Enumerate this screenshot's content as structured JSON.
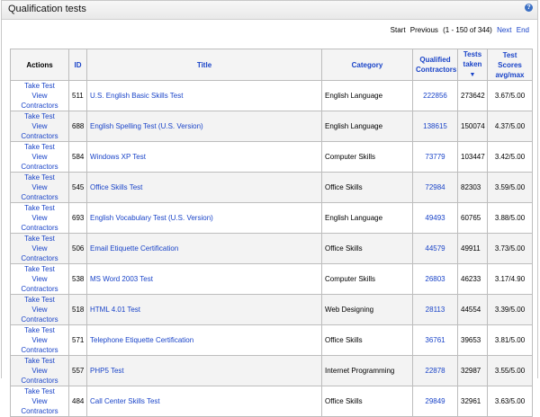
{
  "panel": {
    "title": "Qualification tests",
    "help_icon": "?"
  },
  "pager": {
    "start": "Start",
    "previous": "Previous",
    "range": "(1 - 150 of 344)",
    "next": "Next",
    "end": "End"
  },
  "columns": {
    "actions": "Actions",
    "id": "ID",
    "title": "Title",
    "category": "Category",
    "qualified_line1": "Qualified",
    "qualified_line2": "Contractors",
    "taken_line1": "Tests",
    "taken_line2": "taken",
    "scores_line1": "Test Scores",
    "scores_line2": "avg/max"
  },
  "actions": {
    "take": "Take Test",
    "view": "View Contractors"
  },
  "rows": [
    {
      "id": "511",
      "title": "U.S. English Basic Skills Test",
      "category": "English Language",
      "qualified": "222856",
      "taken": "273642",
      "score": "3.67/5.00"
    },
    {
      "id": "688",
      "title": "English Spelling Test (U.S. Version)",
      "category": "English Language",
      "qualified": "138615",
      "taken": "150074",
      "score": "4.37/5.00"
    },
    {
      "id": "584",
      "title": "Windows XP Test",
      "category": "Computer Skills",
      "qualified": "73779",
      "taken": "103447",
      "score": "3.42/5.00"
    },
    {
      "id": "545",
      "title": "Office Skills Test",
      "category": "Office Skills",
      "qualified": "72984",
      "taken": "82303",
      "score": "3.59/5.00"
    },
    {
      "id": "693",
      "title": "English Vocabulary Test (U.S. Version)",
      "category": "English Language",
      "qualified": "49493",
      "taken": "60765",
      "score": "3.88/5.00"
    },
    {
      "id": "506",
      "title": "Email Etiquette Certification",
      "category": "Office Skills",
      "qualified": "44579",
      "taken": "49911",
      "score": "3.73/5.00"
    },
    {
      "id": "538",
      "title": "MS Word 2003 Test",
      "category": "Computer Skills",
      "qualified": "26803",
      "taken": "46233",
      "score": "3.17/4.90"
    },
    {
      "id": "518",
      "title": "HTML 4.01 Test",
      "category": "Web Designing",
      "qualified": "28113",
      "taken": "44554",
      "score": "3.39/5.00"
    },
    {
      "id": "571",
      "title": "Telephone Etiquette Certification",
      "category": "Office Skills",
      "qualified": "36761",
      "taken": "39653",
      "score": "3.81/5.00"
    },
    {
      "id": "557",
      "title": "PHP5 Test",
      "category": "Internet Programming",
      "qualified": "22878",
      "taken": "32987",
      "score": "3.55/5.00"
    },
    {
      "id": "484",
      "title": "Call Center Skills Test",
      "category": "Office Skills",
      "qualified": "29849",
      "taken": "32961",
      "score": "3.63/5.00"
    }
  ]
}
